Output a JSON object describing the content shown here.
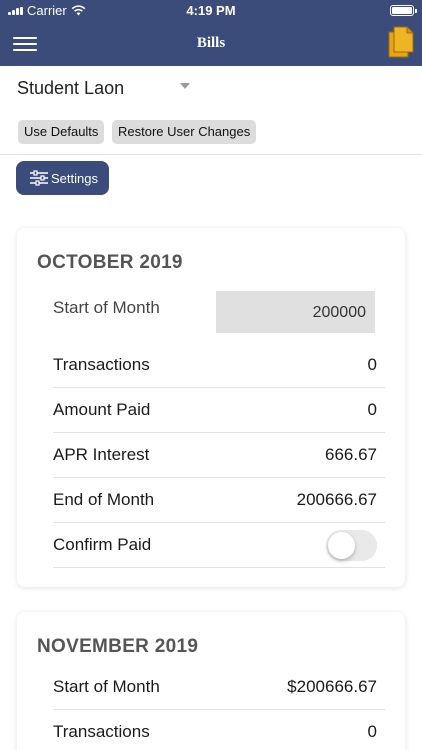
{
  "status_bar": {
    "carrier": "Carrier",
    "time": "4:19 PM"
  },
  "nav": {
    "title": "Bills",
    "menu_icon": "hamburger-menu-icon",
    "document_icon": "document-copy-icon",
    "accent": "#e6a417"
  },
  "picker": {
    "selected": "Student Laon"
  },
  "actions": {
    "use_defaults": "Use Defaults",
    "restore": "Restore User Changes",
    "settings": "Settings"
  },
  "colors": {
    "primary": "#3b4b7a",
    "button_gray": "#dcdcdc"
  },
  "months": [
    {
      "title": "OCTOBER 2019",
      "start_label": "Start of Month",
      "start_value": "200000",
      "rows": [
        {
          "label": "Transactions",
          "value": "0"
        },
        {
          "label": "Amount Paid",
          "value": "0"
        },
        {
          "label": "APR Interest",
          "value": "666.67"
        },
        {
          "label": "End of Month",
          "value": "200666.67"
        }
      ],
      "confirm_label": "Confirm Paid",
      "confirm_on": false
    },
    {
      "title": "NOVEMBER 2019",
      "rows": [
        {
          "label": "Start of Month",
          "value": "$200666.67"
        },
        {
          "label": "Transactions",
          "value": "0"
        }
      ]
    }
  ]
}
